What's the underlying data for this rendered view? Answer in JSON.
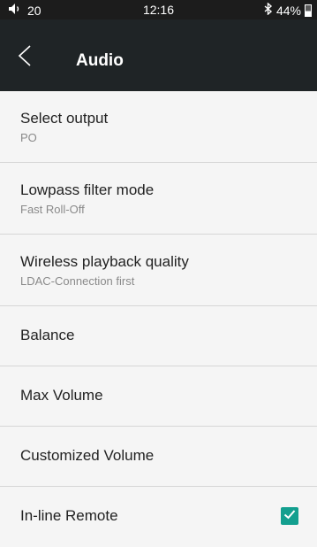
{
  "status_bar": {
    "volume": "20",
    "time": "12:16",
    "battery": "44%",
    "battery_level": 0.44
  },
  "header": {
    "title": "Audio"
  },
  "settings": [
    {
      "title": "Select output",
      "subtitle": "PO"
    },
    {
      "title": "Lowpass filter mode",
      "subtitle": "Fast Roll-Off"
    },
    {
      "title": "Wireless playback quality",
      "subtitle": "LDAC-Connection first"
    },
    {
      "title": "Balance"
    },
    {
      "title": "Max Volume"
    },
    {
      "title": "Customized Volume"
    },
    {
      "title": "In-line Remote",
      "checked": true
    }
  ],
  "colors": {
    "accent": "#139f8f",
    "app_bar": "#1f2426",
    "status_bar": "#1c1c1c",
    "background": "#f5f5f5"
  },
  "icons": {
    "back": "chevron-left-icon",
    "volume": "speaker-icon",
    "bluetooth": "bluetooth-icon",
    "battery": "battery-icon",
    "check": "check-icon"
  }
}
